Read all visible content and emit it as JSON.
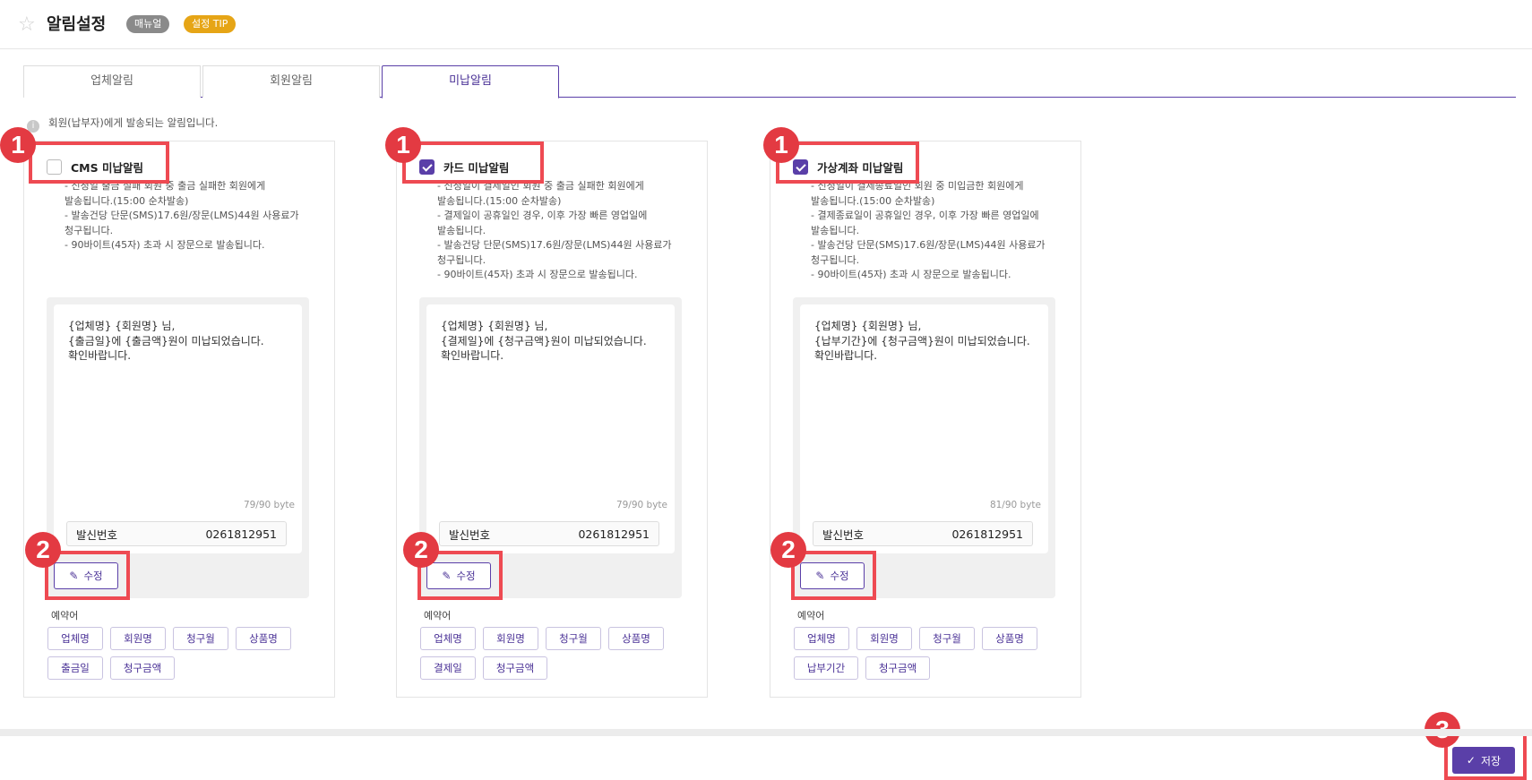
{
  "header": {
    "title": "알림설정",
    "manual_badge": "매뉴얼",
    "tip_badge": "설정 TIP"
  },
  "tabs": [
    {
      "label": "업체알림",
      "active": false
    },
    {
      "label": "회원알림",
      "active": false
    },
    {
      "label": "미납알림",
      "active": true
    }
  ],
  "info_text": "회원(납부자)에게 발송되는 알림입니다.",
  "panels": [
    {
      "title": "CMS 미납알림",
      "checked": false,
      "desc": [
        "- 신청일 출금 실패 회원 중 출금 실패한 회원에게",
        "  발송됩니다.(15:00 순차발송)",
        "- 발송건당 단문(SMS)17.6원/장문(LMS)44원 사용료가",
        "  청구됩니다.",
        "- 90바이트(45자) 초과 시 장문으로 발송됩니다."
      ],
      "message": "{업체명} {회원명} 님,\n{출금일}에 {출금액}원이 미납되었습니다.\n확인바랍니다.",
      "byte_count": "79/90 byte",
      "sender_label": "발신번호",
      "sender_number": "0261812951",
      "edit_label": "수정",
      "reserved_label": "예약어",
      "tags": [
        "업체명",
        "회원명",
        "청구월",
        "상품명",
        "출금일",
        "청구금액"
      ]
    },
    {
      "title": "카드 미납알림",
      "checked": true,
      "desc": [
        "- 신청일이 결제일인 회원 중 출금 실패한 회원에게",
        "  발송됩니다.(15:00 순차발송)",
        "- 결제일이 공휴일인 경우, 이후 가장 빠른 영업일에",
        "  발송됩니다.",
        "- 발송건당 단문(SMS)17.6원/장문(LMS)44원 사용료가",
        "  청구됩니다.",
        "- 90바이트(45자) 초과 시 장문으로 발송됩니다."
      ],
      "message": "{업체명} {회원명} 님,\n{결제일}에 {청구금액}원이 미납되었습니다.\n확인바랍니다.",
      "byte_count": "79/90 byte",
      "sender_label": "발신번호",
      "sender_number": "0261812951",
      "edit_label": "수정",
      "reserved_label": "예약어",
      "tags": [
        "업체명",
        "회원명",
        "청구월",
        "상품명",
        "결제일",
        "청구금액"
      ]
    },
    {
      "title": "가상계좌 미납알림",
      "checked": true,
      "desc": [
        "- 신청일이 결제종료일인 회원 중 미입금한 회원에게",
        "  발송됩니다.(15:00 순차발송)",
        "- 결제종료일이 공휴일인 경우, 이후 가장 빠른 영업일에",
        "  발송됩니다.",
        "- 발송건당 단문(SMS)17.6원/장문(LMS)44원 사용료가",
        "  청구됩니다.",
        "- 90바이트(45자) 초과 시 장문으로 발송됩니다."
      ],
      "message": "{업체명} {회원명} 님,\n{납부기간}에 {청구금액}원이 미납되었습니다.\n확인바랍니다.",
      "byte_count": "81/90 byte",
      "sender_label": "발신번호",
      "sender_number": "0261812951",
      "edit_label": "수정",
      "reserved_label": "예약어",
      "tags": [
        "업체명",
        "회원명",
        "청구월",
        "상품명",
        "납부기간",
        "청구금액"
      ]
    }
  ],
  "markers": {
    "one": "1",
    "two": "2",
    "three": "3"
  },
  "save_label": "저장",
  "colors": {
    "accent": "#5a3fa8",
    "highlight": "#ee4a52",
    "tip": "#e6a516"
  }
}
